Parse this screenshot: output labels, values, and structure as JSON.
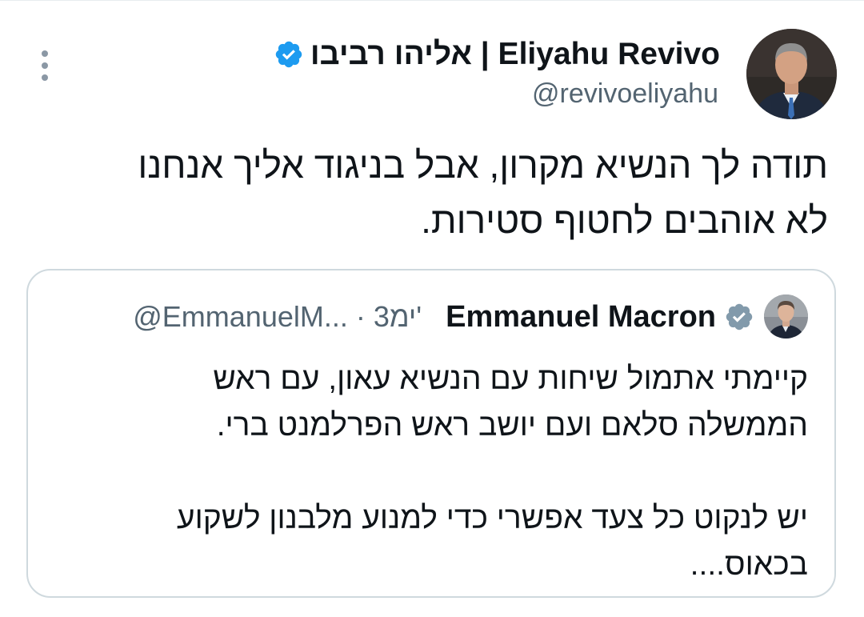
{
  "tweet": {
    "author": {
      "display_name": "אליהו רביבו | Eliyahu Revivo",
      "handle": "@revivoeliyahu",
      "verified": true
    },
    "text_lines": [
      "תודה לך הנשיא מקרון, אבל בניגוד אליך אנחנו",
      "לא אוהבים לחטוף סטירות."
    ]
  },
  "quoted_tweet": {
    "author": {
      "display_name": "Emmanuel Macron",
      "handle_truncated": "@EmmanuelM...",
      "verified": true
    },
    "time_meta": "@EmmanuelM... · 3ימ'",
    "text_lines": [
      "קיימתי אתמול שיחות עם הנשיא עאון, עם ראש",
      "הממשלה סלאם ועם יושב ראש הפרלמנט ברי.",
      "",
      "יש לנקוט כל צעד אפשרי כדי למנוע מלבנון לשקוע",
      "בכאוס...."
    ]
  },
  "icons": {
    "more": "more-vertical-icon",
    "verified": "verified-badge-icon"
  },
  "colors": {
    "verified_blue": "#1d9bf0",
    "text_primary": "#0f1419",
    "text_secondary": "#536471",
    "border": "#cfd9de"
  }
}
